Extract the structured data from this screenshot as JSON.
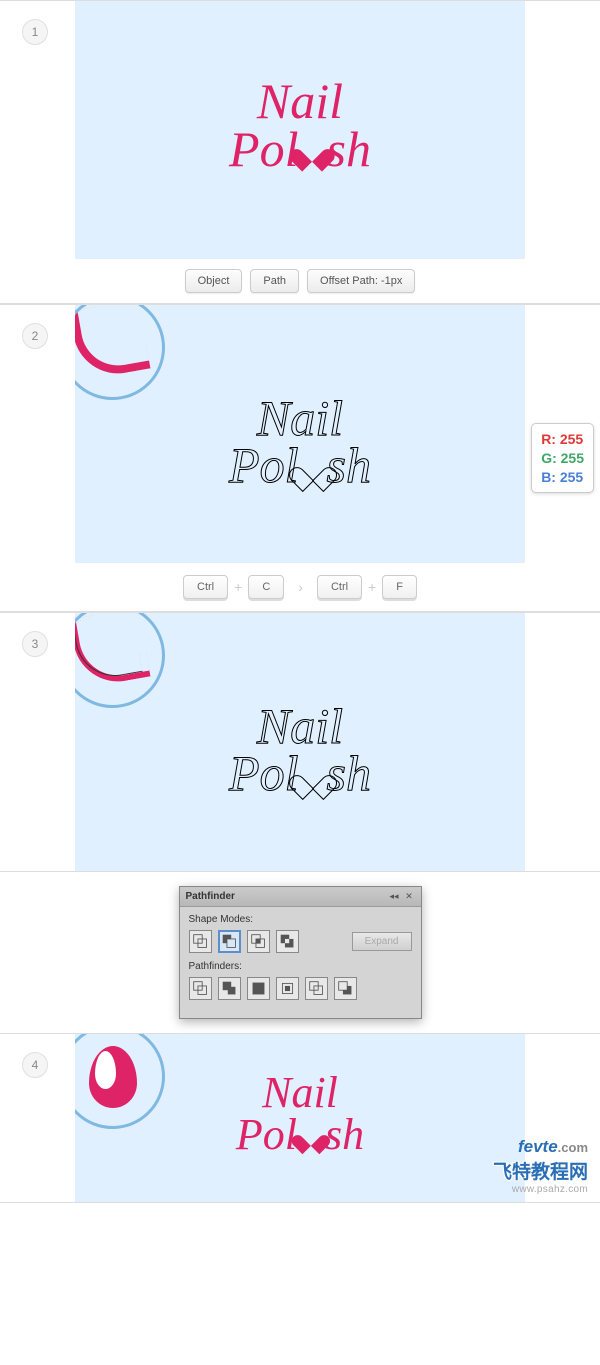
{
  "steps": {
    "s1": {
      "num": "1"
    },
    "s2": {
      "num": "2"
    },
    "s3": {
      "num": "3"
    },
    "s4": {
      "num": "4"
    }
  },
  "text": {
    "line1": "Nail",
    "line2_a": "Pol",
    "line2_b": "sh"
  },
  "buttons": {
    "object": "Object",
    "path": "Path",
    "offset": "Offset Path: -1px"
  },
  "keys": {
    "ctrl": "Ctrl",
    "c": "C",
    "f": "F",
    "plus": "+",
    "arrow": "›"
  },
  "rgb": {
    "r": "R: 255",
    "g": "G: 255",
    "b": "B: 255"
  },
  "pathfinder": {
    "title": "Pathfinder",
    "shapeModes": "Shape Modes:",
    "pathfinders": "Pathfinders:",
    "expand": "Expand"
  },
  "watermark": {
    "line1a": "fevte",
    "line1b": ".com",
    "line2": "飞特教程网",
    "line3": "www.psahz.com"
  }
}
